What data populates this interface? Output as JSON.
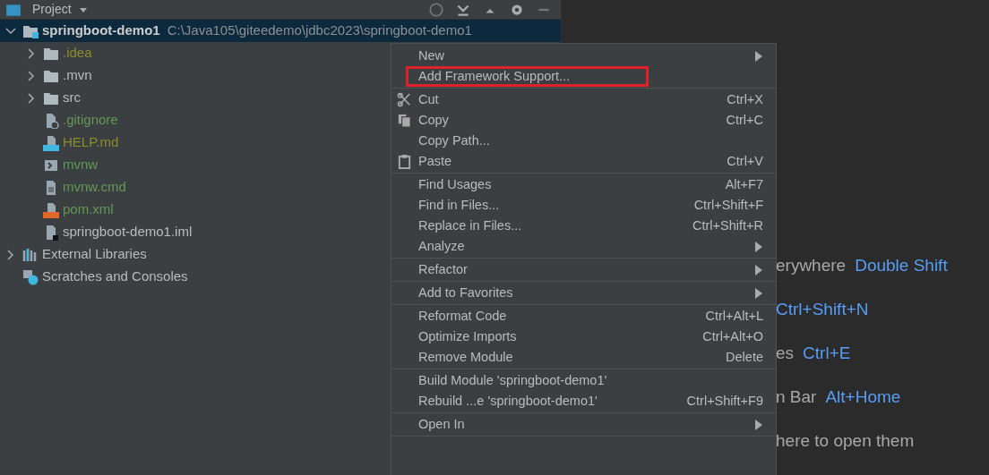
{
  "project_panel": {
    "title": "Project"
  },
  "tree": [
    {
      "label": "springboot-demo1",
      "path": "C:\\Java105\\giteedemo\\jdbc2023\\springboot-demo1",
      "kind": "module",
      "expanded": true,
      "selected": true,
      "children": [
        {
          "label": ".idea",
          "kind": "folder",
          "expanded": false,
          "selected": false,
          "color": "#8c8c2a"
        },
        {
          "label": ".mvn",
          "kind": "folder",
          "expanded": false,
          "selected": false,
          "color": "#bbbbbb"
        },
        {
          "label": "src",
          "kind": "folder",
          "expanded": false,
          "selected": false,
          "color": "#bbbbbb"
        },
        {
          "label": ".gitignore",
          "kind": "file-ignore",
          "selected": false,
          "color": "#629755"
        },
        {
          "label": "HELP.md",
          "kind": "file-md",
          "selected": false,
          "color": "#8c8c2a"
        },
        {
          "label": "mvnw",
          "kind": "file-script",
          "selected": false,
          "color": "#629755"
        },
        {
          "label": "mvnw.cmd",
          "kind": "file-text",
          "selected": false,
          "color": "#629755"
        },
        {
          "label": "pom.xml",
          "kind": "file-xml",
          "selected": false,
          "color": "#629755"
        },
        {
          "label": "springboot-demo1.iml",
          "kind": "file-iml",
          "selected": false,
          "color": "#bbbbbb"
        }
      ]
    },
    {
      "label": "External Libraries",
      "kind": "libraries",
      "expanded": false,
      "selected": false
    },
    {
      "label": "Scratches and Consoles",
      "kind": "scratches",
      "selected": false
    }
  ],
  "context_menu": {
    "sections": [
      [
        {
          "label": "New",
          "submenu": true
        },
        {
          "label": "Add Framework Support...",
          "highlighted": true
        }
      ],
      [
        {
          "label": "Cut",
          "shortcut": "Ctrl+X",
          "has_icon": true
        },
        {
          "label": "Copy",
          "shortcut": "Ctrl+C",
          "has_icon": true
        },
        {
          "label": "Copy Path..."
        },
        {
          "label": "Paste",
          "shortcut": "Ctrl+V",
          "has_icon": true
        }
      ],
      [
        {
          "label": "Find Usages",
          "shortcut": "Alt+F7"
        },
        {
          "label": "Find in Files...",
          "shortcut": "Ctrl+Shift+F"
        },
        {
          "label": "Replace in Files...",
          "shortcut": "Ctrl+Shift+R"
        },
        {
          "label": "Analyze",
          "submenu": true
        }
      ],
      [
        {
          "label": "Refactor",
          "submenu": true
        }
      ],
      [
        {
          "label": "Add to Favorites",
          "submenu": true
        }
      ],
      [
        {
          "label": "Reformat Code",
          "shortcut": "Ctrl+Alt+L"
        },
        {
          "label": "Optimize Imports",
          "shortcut": "Ctrl+Alt+O"
        },
        {
          "label": "Remove Module",
          "shortcut": "Delete"
        }
      ],
      [
        {
          "label": "Build Module 'springboot-demo1'"
        },
        {
          "label": "Rebuild ...e 'springboot-demo1'",
          "shortcut": "Ctrl+Shift+F9"
        }
      ],
      [
        {
          "label": "Open In",
          "submenu": true
        }
      ]
    ]
  },
  "editor_hints": [
    {
      "label": "erywhere",
      "shortcut": "Double Shift"
    },
    {
      "shortcut": "Ctrl+Shift+N"
    },
    {
      "label": "es",
      "shortcut": "Ctrl+E"
    },
    {
      "label": "n Bar",
      "shortcut": "Alt+Home"
    },
    {
      "label": "here to open them"
    }
  ]
}
